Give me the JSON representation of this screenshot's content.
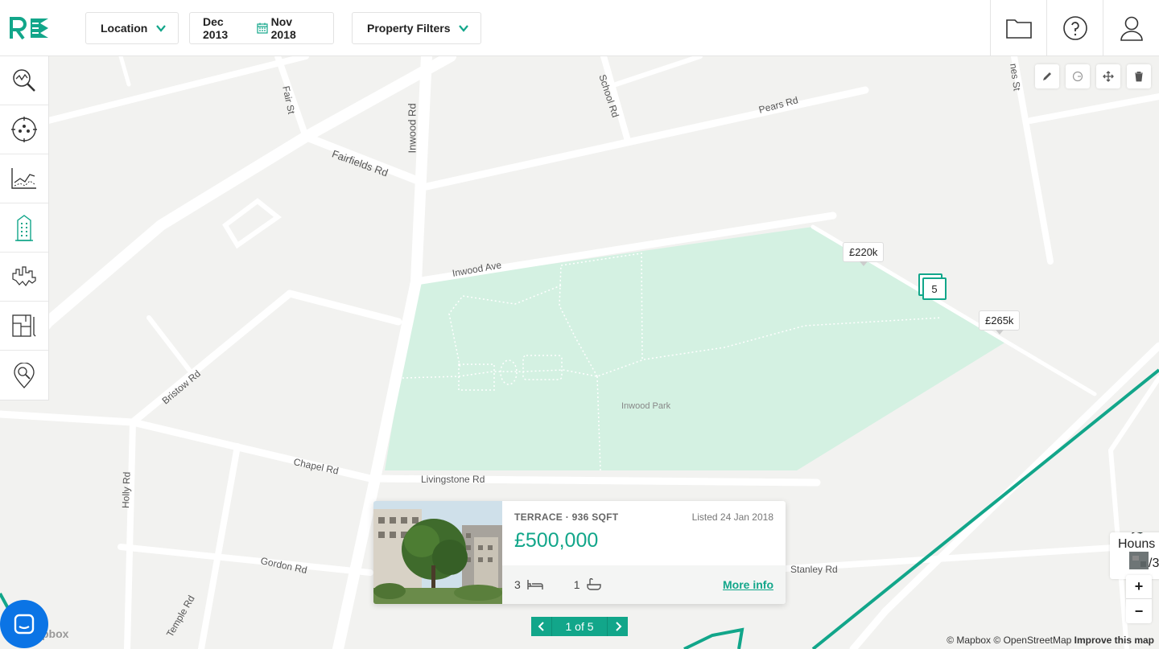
{
  "header": {
    "logo_alt": "R",
    "location_label": "Location",
    "date_start": "Dec 2013",
    "date_end": "Nov 2018",
    "property_filters_label": "Property Filters"
  },
  "sidebar": {
    "items": [
      {
        "name": "market-analysis",
        "icon": "magnify-chart-icon"
      },
      {
        "name": "demographics",
        "icon": "people-target-icon"
      },
      {
        "name": "trends",
        "icon": "line-chart-icon"
      },
      {
        "name": "buildings",
        "icon": "building-icon"
      },
      {
        "name": "skyline",
        "icon": "skyline-icon"
      },
      {
        "name": "floorplans",
        "icon": "floorplan-icon"
      },
      {
        "name": "location-search",
        "icon": "map-pin-search-icon"
      }
    ]
  },
  "map": {
    "labels": {
      "fair_st": "Fair St",
      "inwood_rd": "Inwood Rd",
      "school_rd": "School Rd",
      "pears_rd": "Pears Rd",
      "fairfields_rd": "Fairfields Rd",
      "inwood_ave": "Inwood Ave",
      "bristow_rd": "Bristow Rd",
      "inwood_park": "Inwood Park",
      "chapel_rd": "Chapel Rd",
      "livingstone_rd": "Livingstone Rd",
      "holly_rd": "Holly Rd",
      "gordon_rd": "Gordon Rd",
      "temple_rd": "Temple Rd",
      "stanley_rd": "Stanley Rd",
      "nes_st": "nes St",
      "houns": "Houns",
      "houns_sub": "/3"
    },
    "markers": {
      "price_1": "£220k",
      "price_2": "£265k",
      "cluster_count": "5"
    },
    "attribution": {
      "mapbox": "© Mapbox",
      "osm": "© OpenStreetMap",
      "improve": "Improve this map"
    },
    "watermark": "pbox",
    "zoom_in": "+",
    "zoom_out": "−"
  },
  "card": {
    "type_size": "TERRACE · 936 SQFT",
    "listed": "Listed 24 Jan 2018",
    "price": "£500,000",
    "beds": "3",
    "baths": "1",
    "more_info": "More info"
  },
  "pager": {
    "prev": "‹",
    "count": "1 of 5",
    "next": "›"
  },
  "colors": {
    "accent": "#12a68a",
    "park": "#d4f1e2",
    "road": "#ffffff",
    "land": "#f2f2f0"
  }
}
